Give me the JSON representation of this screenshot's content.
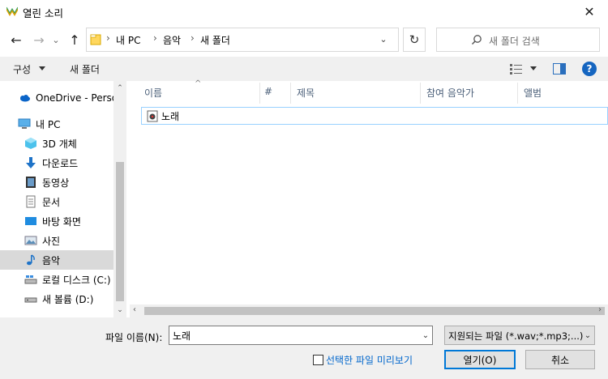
{
  "window": {
    "title": "열린 소리",
    "close_glyph": "✕"
  },
  "nav": {
    "back_glyph": "←",
    "forward_glyph": "→",
    "recent_glyph": "⌄",
    "up_glyph": "↑",
    "breadcrumb": [
      "내 PC",
      "음악",
      "새 폴더"
    ],
    "separator": "›",
    "refresh_glyph": "↻",
    "search_placeholder": "새 폴더 검색"
  },
  "toolbar": {
    "organize_label": "구성",
    "new_folder_label": "새 폴더",
    "help_label": "?"
  },
  "sidebar": {
    "items": [
      {
        "label": "OneDrive - Personal",
        "icon": "onedrive-icon"
      },
      {
        "label": "내 PC",
        "icon": "pc-icon"
      },
      {
        "label": "3D 개체",
        "icon": "3d-objects-icon"
      },
      {
        "label": "다운로드",
        "icon": "download-icon"
      },
      {
        "label": "동영상",
        "icon": "video-icon"
      },
      {
        "label": "문서",
        "icon": "document-icon"
      },
      {
        "label": "바탕 화면",
        "icon": "desktop-icon"
      },
      {
        "label": "사진",
        "icon": "pictures-icon"
      },
      {
        "label": "음악",
        "icon": "music-icon",
        "selected": true
      },
      {
        "label": "로컬 디스크 (C:)",
        "icon": "local-disk-icon"
      },
      {
        "label": "새 볼륨 (D:)",
        "icon": "volume-icon"
      }
    ]
  },
  "file_list": {
    "columns": [
      "이름",
      "#",
      "제목",
      "참여 음악가",
      "앨범"
    ],
    "sort_glyph": "^",
    "files": [
      {
        "name": "노래",
        "icon": "audio-file-icon"
      }
    ]
  },
  "footer": {
    "filename_label": "파일 이름(N):",
    "filename_value": "노래",
    "filter_value": "지원되는 파일 (*.wav;*.mp3;...)",
    "preview_label": "선택한 파일 미리보기",
    "open_label": "열기(O)",
    "cancel_label": "취소"
  },
  "colors": {
    "accent": "#0078d7",
    "link": "#0066cc",
    "selection": "#d9d9d9"
  }
}
